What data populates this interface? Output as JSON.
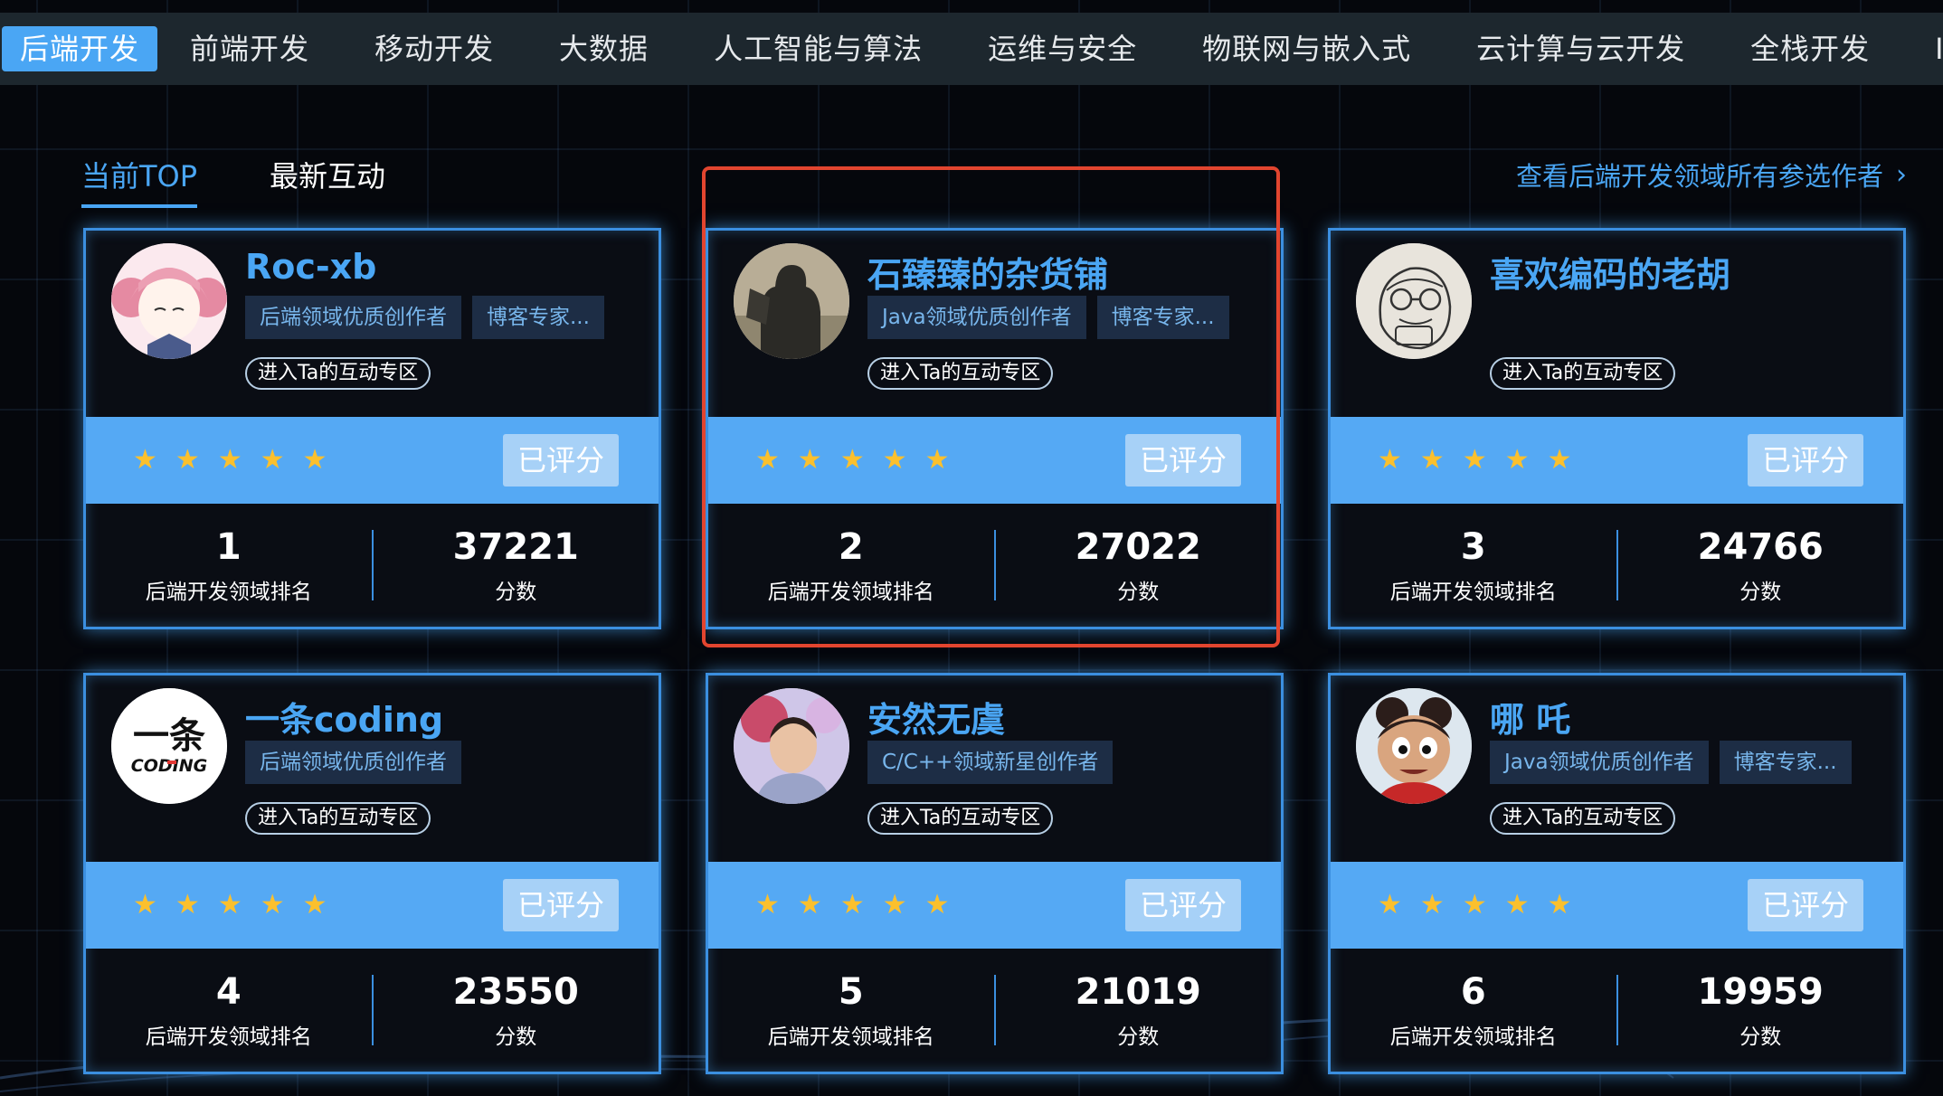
{
  "nav": {
    "items": [
      "后端开发",
      "前端开发",
      "移动开发",
      "大数据",
      "人工智能与算法",
      "运维与安全",
      "物联网与嵌入式",
      "云计算与云开发",
      "全栈开发",
      "IT其他"
    ],
    "active_index": 0
  },
  "subtabs": [
    "当前TOP",
    "最新互动"
  ],
  "view_all": "查看后端开发领域所有参选作者",
  "colors": {
    "accent": "#4aa6f4",
    "highlight": "#e2452f",
    "star": "#fbc02d",
    "rating_bar": "#55a9f4"
  },
  "common": {
    "enter_zone": "进入Ta的互动专区",
    "rated_label": "已评分",
    "rank_label": "后端开发领域排名",
    "score_label": "分数",
    "star_icon": "★"
  },
  "authors": [
    {
      "name": "Roc-xb",
      "badges": [
        "后端领域优质创作者",
        "博客专家..."
      ],
      "rank": "1",
      "score": "37221",
      "stars": 5,
      "avatar": "anime-girl-pink-hair"
    },
    {
      "name": "石臻臻的杂货铺",
      "badges": [
        "Java领域优质创作者",
        "博客专家..."
      ],
      "rank": "2",
      "score": "27022",
      "stars": 5,
      "avatar": "photo-shadow"
    },
    {
      "name": "喜欢编码的老胡",
      "badges": [],
      "rank": "3",
      "score": "24766",
      "stars": 5,
      "avatar": "sketch-glasses-face"
    },
    {
      "name": "一条coding",
      "badges": [
        "后端领域优质创作者"
      ],
      "rank": "4",
      "score": "23550",
      "stars": 5,
      "avatar": "calligraphy-coding-logo",
      "avatar_text": [
        "一条",
        "CODING"
      ]
    },
    {
      "name": "安然无虞",
      "badges": [
        "C/C++领域新星创作者"
      ],
      "rank": "5",
      "score": "21019",
      "stars": 5,
      "avatar": "photo-person"
    },
    {
      "name": "哪 吒",
      "badges": [
        "Java领域优质创作者",
        "博客专家..."
      ],
      "rank": "6",
      "score": "19959",
      "stars": 5,
      "avatar": "cartoon-nezha"
    }
  ]
}
